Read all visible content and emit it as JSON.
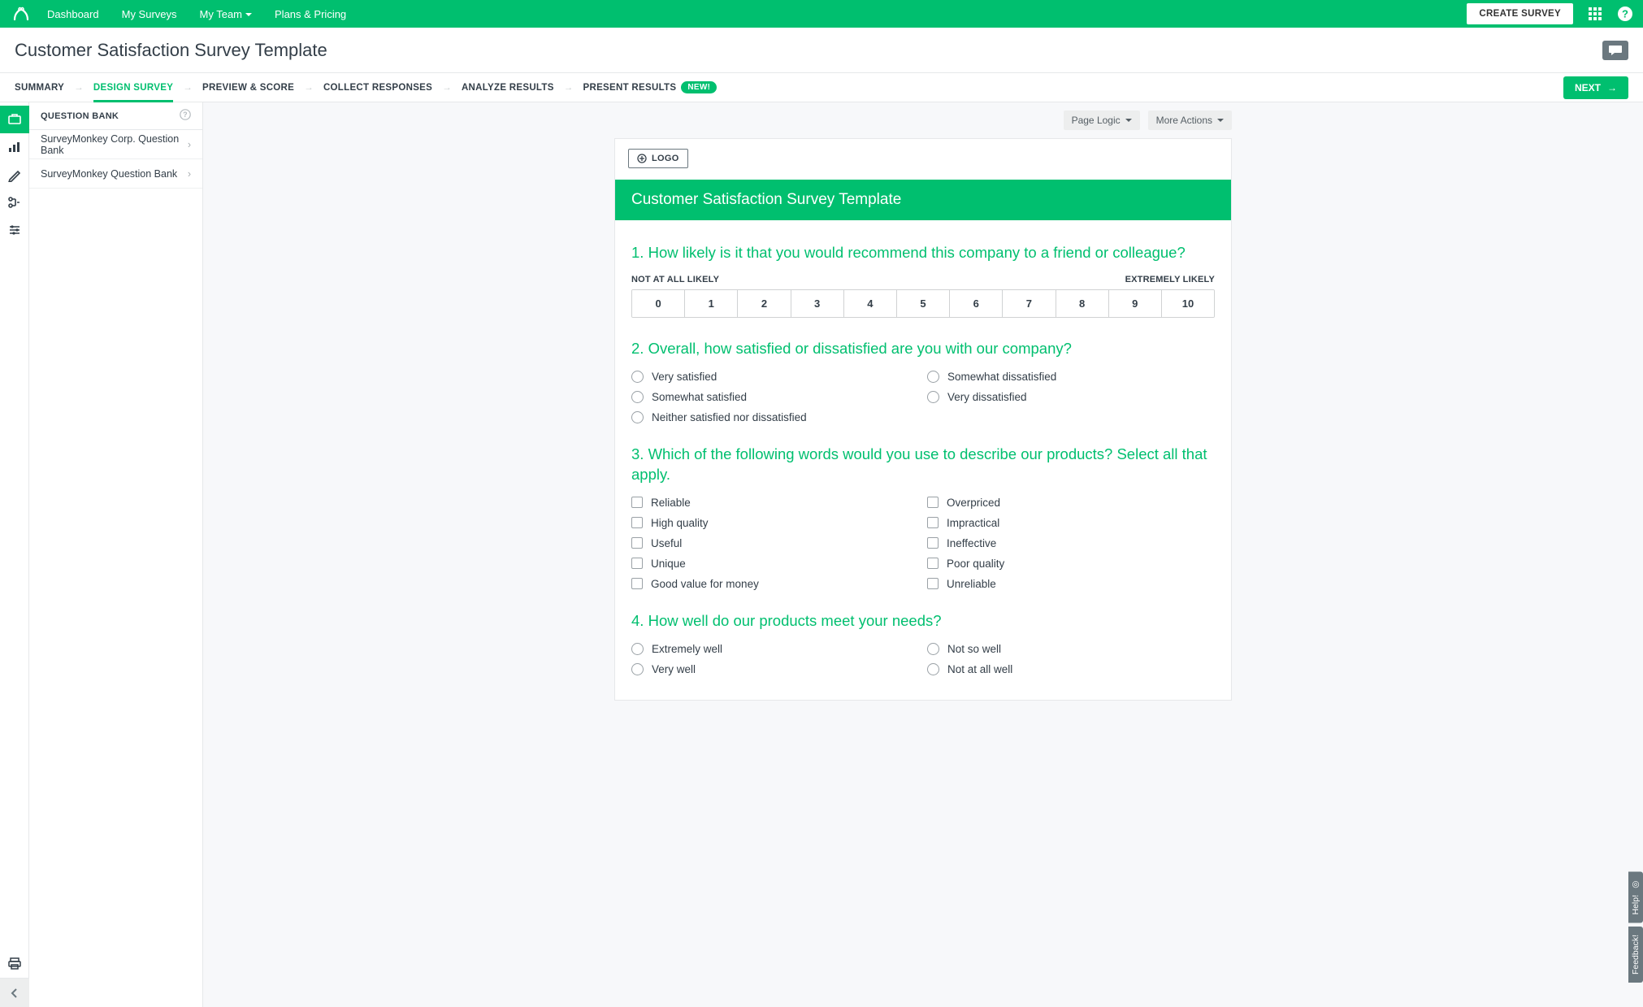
{
  "header": {
    "nav": {
      "dashboard": "Dashboard",
      "my_surveys": "My Surveys",
      "my_team": "My Team",
      "plans": "Plans & Pricing"
    },
    "create_button": "CREATE SURVEY"
  },
  "page": {
    "title": "Customer Satisfaction Survey Template"
  },
  "steps": {
    "summary": "SUMMARY",
    "design": "DESIGN SURVEY",
    "preview": "PREVIEW & SCORE",
    "collect": "COLLECT RESPONSES",
    "analyze": "ANALYZE RESULTS",
    "present": "PRESENT RESULTS",
    "present_badge": "NEW!",
    "next": "NEXT"
  },
  "sidebar": {
    "heading": "QUESTION BANK",
    "rows": {
      "corp_bank": "SurveyMonkey Corp. Question Bank",
      "sm_bank": "SurveyMonkey Question Bank"
    }
  },
  "page_actions": {
    "page_logic": "Page Logic",
    "more_actions": "More Actions"
  },
  "survey": {
    "logo_label": "LOGO",
    "title": "Customer Satisfaction Survey Template",
    "q1": {
      "num": "1.",
      "text": "How likely is it that you would recommend this company to a friend or colleague?",
      "left_anchor": "NOT AT ALL LIKELY",
      "right_anchor": "EXTREMELY LIKELY",
      "scale": [
        "0",
        "1",
        "2",
        "3",
        "4",
        "5",
        "6",
        "7",
        "8",
        "9",
        "10"
      ]
    },
    "q2": {
      "num": "2.",
      "text": "Overall, how satisfied or dissatisfied are you with our company?",
      "options": [
        "Very satisfied",
        "Somewhat satisfied",
        "Neither satisfied nor dissatisfied",
        "Somewhat dissatisfied",
        "Very dissatisfied"
      ]
    },
    "q3": {
      "num": "3.",
      "text": "Which of the following words would you use to describe our products? Select all that apply.",
      "options": [
        "Reliable",
        "High quality",
        "Useful",
        "Unique",
        "Good value for money",
        "Overpriced",
        "Impractical",
        "Ineffective",
        "Poor quality",
        "Unreliable"
      ]
    },
    "q4": {
      "num": "4.",
      "text": "How well do our products meet your needs?",
      "options": [
        "Extremely well",
        "Very well",
        "Not so well",
        "Not at all well"
      ]
    }
  },
  "side_tabs": {
    "help": "Help!",
    "feedback": "Feedback!"
  }
}
